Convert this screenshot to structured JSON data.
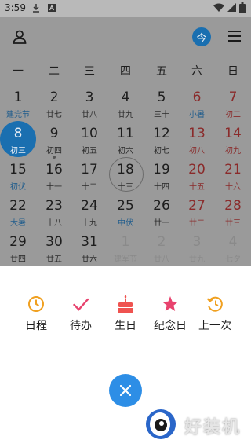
{
  "status_bar": {
    "time": "3:59"
  },
  "header": {
    "today_badge": "今"
  },
  "weekdays": [
    "一",
    "二",
    "三",
    "四",
    "五",
    "六",
    "日"
  ],
  "calendar": {
    "days": [
      {
        "n": "1",
        "s": "建党节",
        "type": "holiday"
      },
      {
        "n": "2",
        "s": "廿七"
      },
      {
        "n": "3",
        "s": "廿八"
      },
      {
        "n": "4",
        "s": "廿九"
      },
      {
        "n": "5",
        "s": "三十"
      },
      {
        "n": "6",
        "s": "小暑",
        "type": "weekend-term"
      },
      {
        "n": "7",
        "s": "初二",
        "type": "weekend"
      },
      {
        "n": "8",
        "s": "初三",
        "type": "selected"
      },
      {
        "n": "9",
        "s": "初四",
        "dot": true
      },
      {
        "n": "10",
        "s": "初五"
      },
      {
        "n": "11",
        "s": "初六"
      },
      {
        "n": "12",
        "s": "初七"
      },
      {
        "n": "13",
        "s": "初八",
        "type": "weekend"
      },
      {
        "n": "14",
        "s": "初九",
        "type": "weekend"
      },
      {
        "n": "15",
        "s": "初伏",
        "type": "holiday"
      },
      {
        "n": "16",
        "s": "十一"
      },
      {
        "n": "17",
        "s": "十二"
      },
      {
        "n": "18",
        "s": "十三",
        "type": "today"
      },
      {
        "n": "19",
        "s": "十四"
      },
      {
        "n": "20",
        "s": "十五",
        "type": "weekend"
      },
      {
        "n": "21",
        "s": "十六",
        "type": "weekend"
      },
      {
        "n": "22",
        "s": "大暑",
        "type": "holiday"
      },
      {
        "n": "23",
        "s": "十八"
      },
      {
        "n": "24",
        "s": "十九"
      },
      {
        "n": "25",
        "s": "中伏",
        "type": "holiday"
      },
      {
        "n": "26",
        "s": "廿一"
      },
      {
        "n": "27",
        "s": "廿二",
        "type": "weekend"
      },
      {
        "n": "28",
        "s": "廿三",
        "type": "weekend"
      },
      {
        "n": "29",
        "s": "廿四"
      },
      {
        "n": "30",
        "s": "廿五"
      },
      {
        "n": "31",
        "s": "廿六"
      },
      {
        "n": "1",
        "s": "建军节",
        "type": "faded"
      },
      {
        "n": "2",
        "s": "廿八",
        "type": "faded"
      },
      {
        "n": "3",
        "s": "廿九",
        "type": "faded"
      },
      {
        "n": "4",
        "s": "七夕",
        "type": "faded"
      }
    ]
  },
  "actions": [
    {
      "label": "日程",
      "icon": "clock-icon",
      "color": "#f0a020"
    },
    {
      "label": "待办",
      "icon": "checkmark-icon",
      "color": "#e8436e"
    },
    {
      "label": "生日",
      "icon": "cake-icon",
      "color": "#ef5350"
    },
    {
      "label": "纪念日",
      "icon": "star-icon",
      "color": "#e8436e"
    },
    {
      "label": "上一次",
      "icon": "history-icon",
      "color": "#f0a020"
    }
  ],
  "watermark": {
    "text": "好装机"
  },
  "colors": {
    "accent": "#2d8ee6",
    "selected": "#1a6fb0"
  }
}
